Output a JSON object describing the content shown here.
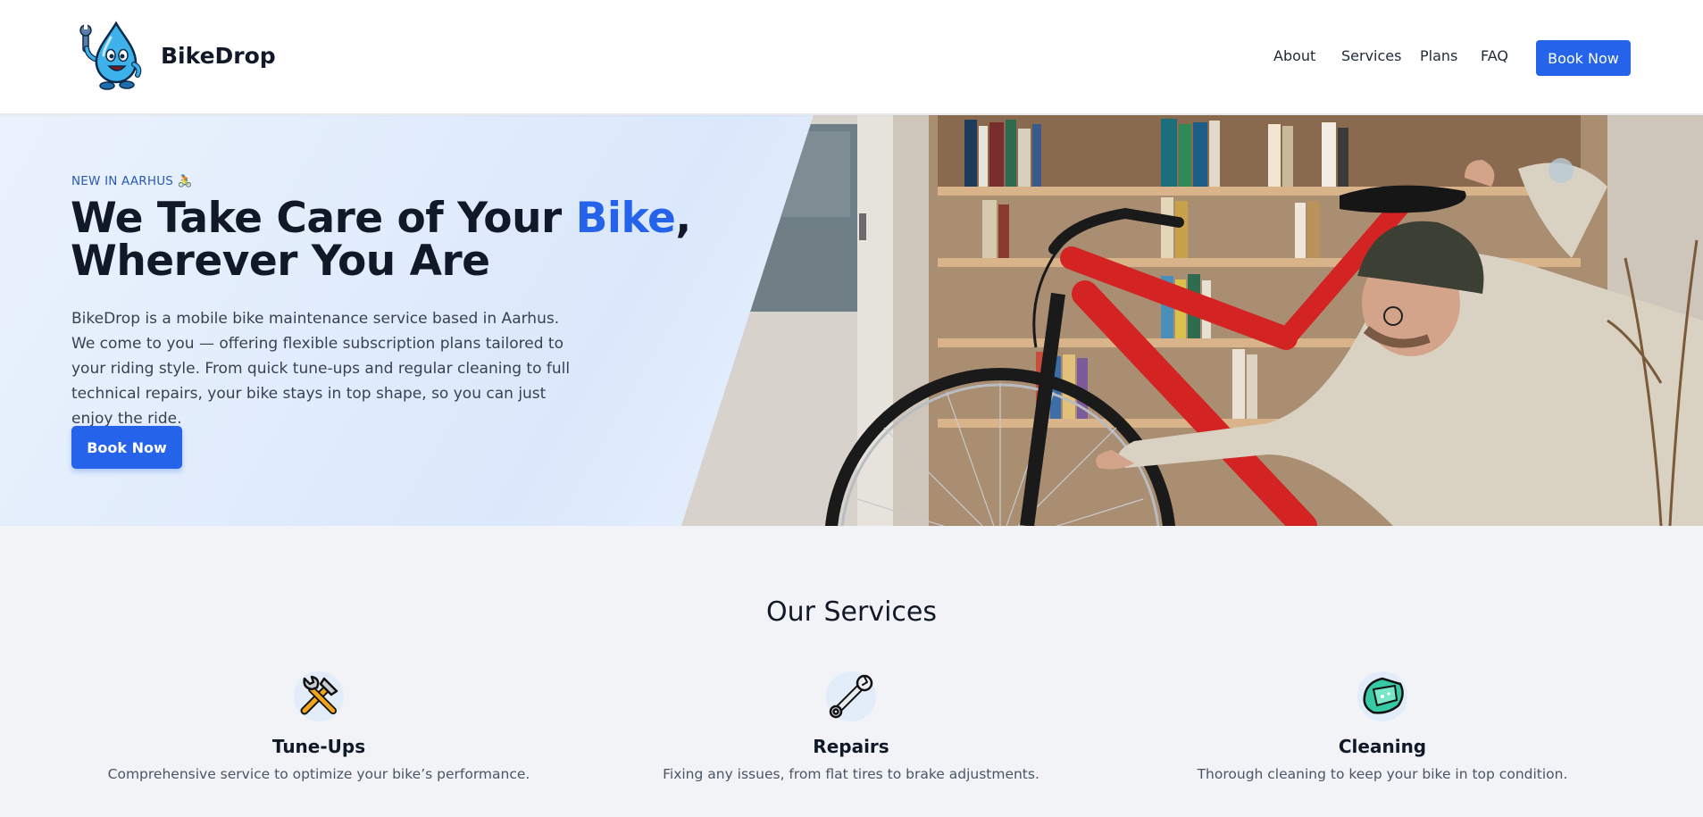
{
  "header": {
    "brand": "BikeDrop",
    "nav": [
      {
        "label": "About"
      },
      {
        "label": "Services"
      },
      {
        "label": "Plans"
      },
      {
        "label": "FAQ"
      }
    ],
    "cta_label": "Book Now"
  },
  "hero": {
    "kicker": "NEW IN AARHUS 🚴",
    "title_part1": "We Take Care of Your ",
    "title_accent": "Bike",
    "title_part2": ",",
    "title_line2": "Wherever You Are",
    "description": "BikeDrop is a mobile bike maintenance service based in Aarhus. We come to you — offering flexible subscription plans tailored to your riding style. From quick tune-ups and regular cleaning to full technical repairs, your bike stays in top shape, so you can just enjoy the ride.",
    "cta_label": "Book Now"
  },
  "services": {
    "title": "Our Services",
    "items": [
      {
        "name": "Tune-Ups",
        "description": "Comprehensive service to optimize your bike’s performance.",
        "icon": "hammer-wrench-icon"
      },
      {
        "name": "Repairs",
        "description": "Fixing any issues, from flat tires to brake adjustments.",
        "icon": "wrench-icon"
      },
      {
        "name": "Cleaning",
        "description": "Thorough cleaning to keep your bike in top condition.",
        "icon": "sponge-icon"
      }
    ]
  },
  "colors": {
    "accent": "#2563eb",
    "heading": "#111827",
    "body_text": "#374151",
    "page_background": "#f1f3f6"
  }
}
